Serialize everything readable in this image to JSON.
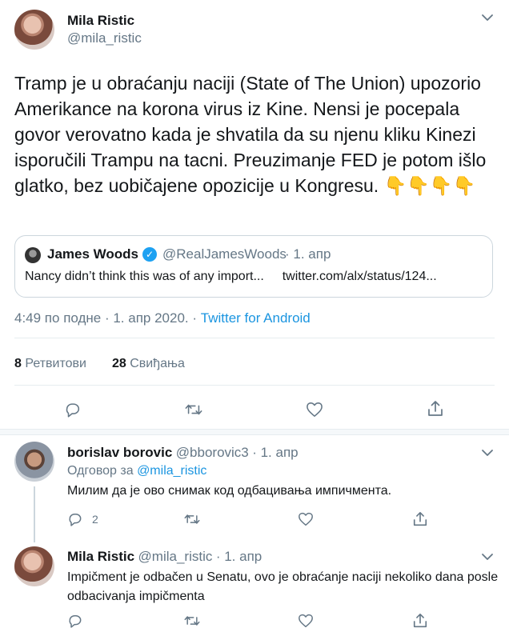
{
  "main_tweet": {
    "author_name": "Mila Ristic",
    "author_handle": "@mila_ristic",
    "text": "Tramp je u obraćanju naciji (State of The Union) upozorio Amerikance na korona virus iz Kine. Nensi je pocepala govor verovatno kada je shvatila da su njenu kliku Kinezi isporučili Trampu na tacni. Preuzimanje FED je potom išlo glatko, bez uobičajene opozicije u Kongresu. 👇👇👇👇",
    "quote": {
      "author_name": "James Woods",
      "author_handle": "@RealJamesWoods",
      "date": "· 1. апр",
      "text": "Nancy didn’t think this was of any import...",
      "link": "twitter.com/alx/status/124..."
    },
    "timestamp": "4:49 по подне · 1. апр 2020. · ",
    "source": "Twitter for Android",
    "retweets_count": "8",
    "retweets_label": "Ретвитови",
    "likes_count": "28",
    "likes_label": "Свиђања"
  },
  "replies": [
    {
      "author_name": "borislav borovic",
      "author_handle": "@bborovic3",
      "date": "· 1. апр",
      "reply_to_prefix": "Одговор за",
      "reply_to_handle": "@mila_ristic",
      "text": "Милим да је ово снимак код одбацивања импичмента.",
      "reply_count": "2"
    },
    {
      "author_name": "Mila Ristic",
      "author_handle": "@mila_ristic",
      "date": "· 1. апр",
      "text": "Impičment je odbačen u Senatu, ovo je obraćanje naciji nekoliko dana posle odbacivanja impičmenta"
    }
  ],
  "icons": {
    "reply": "reply-icon",
    "retweet": "retweet-icon",
    "like": "like-icon",
    "share": "share-icon",
    "chevron": "chevron-down-icon",
    "verified": "verified-badge-icon"
  },
  "colors": {
    "link": "#1b95e0",
    "secondary_text": "#657786",
    "verified": "#1da1f2",
    "divider": "#e6ecf0"
  }
}
